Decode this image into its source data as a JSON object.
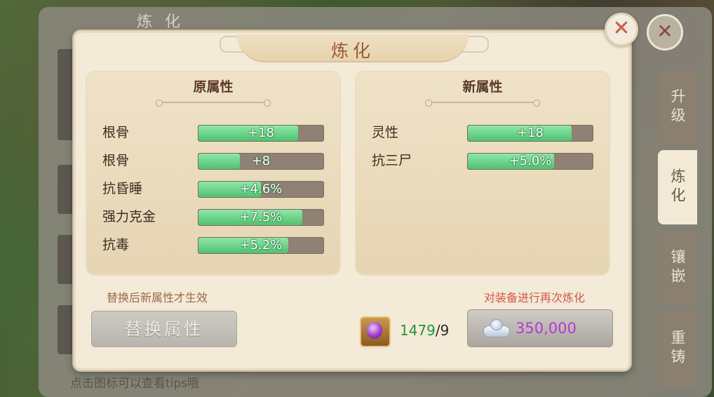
{
  "background": {
    "panel_title": "炼化",
    "footer_hint": "点击图标可以查看tips哦"
  },
  "side_tabs": [
    {
      "label": "升级",
      "active": false
    },
    {
      "label": "炼化",
      "active": true
    },
    {
      "label": "镶嵌",
      "active": false
    },
    {
      "label": "重铸",
      "active": false
    }
  ],
  "dialog": {
    "title": "炼化",
    "close_symbol": "✕",
    "original": {
      "title": "原属性",
      "rows": [
        {
          "label": "根骨",
          "value": "+18",
          "fill": 0.8
        },
        {
          "label": "根骨",
          "value": "+8",
          "fill": 0.33
        },
        {
          "label": "抗昏睡",
          "value": "+4.6%",
          "fill": 0.5
        },
        {
          "label": "强力克金",
          "value": "+7.5%",
          "fill": 0.83
        },
        {
          "label": "抗毒",
          "value": "+5.2%",
          "fill": 0.72
        }
      ]
    },
    "new": {
      "title": "新属性",
      "rows": [
        {
          "label": "灵性",
          "value": "+18",
          "fill": 0.83
        },
        {
          "label": "抗三尸",
          "value": "+5.0%",
          "fill": 0.69
        }
      ]
    },
    "replace_hint": "替换后新属性才生效",
    "refine_hint": "对装备进行再次炼化",
    "replace_button": "替换属性",
    "gem": {
      "icon": "purple-gem-icon",
      "owned": "1479",
      "separator": "/",
      "required": "9"
    },
    "refine_button": {
      "icon": "silver-ingot-icon",
      "cost": "350,000"
    }
  },
  "colors": {
    "accent_green": "#1a9a3c",
    "cost_purple": "#b43bd0",
    "hint_brown": "#9a6a4a",
    "hint_red": "#d8574a",
    "title_brown": "#9a5a3e"
  }
}
